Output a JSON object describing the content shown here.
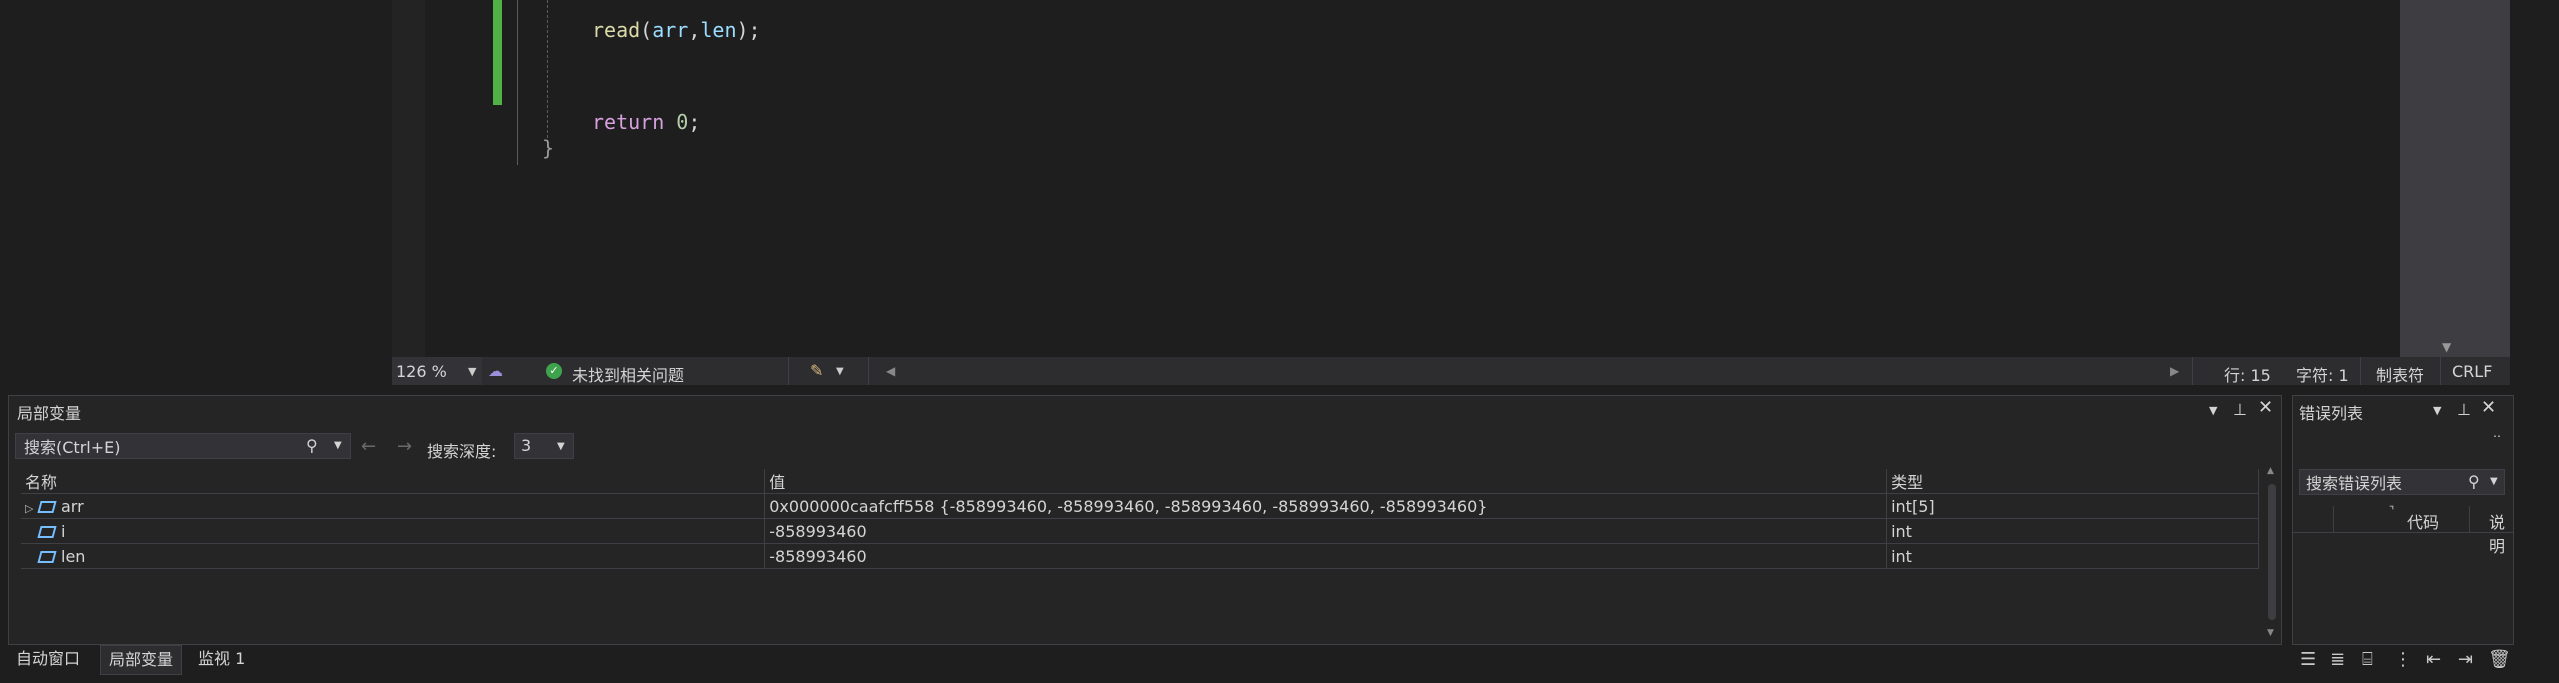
{
  "editor": {
    "line_read": {
      "fn": "read",
      "open": "(",
      "arg1": "arr",
      "comma": ",",
      "arg2": "len",
      "close": ");"
    },
    "line_return": {
      "kw": "return",
      "space": " ",
      "num": "0",
      "semi": ";"
    },
    "brace": "}"
  },
  "status": {
    "zoom": "126 %",
    "issues": "未找到相关问题",
    "line": "行: 15",
    "col": "字符: 1",
    "tabs": "制表符",
    "eol": "CRLF"
  },
  "locals": {
    "title": "局部变量",
    "search_placeholder": "搜索(Ctrl+E)",
    "depth_label": "搜索深度:",
    "depth_value": "3",
    "columns": {
      "name": "名称",
      "value": "值",
      "type": "类型"
    },
    "rows": [
      {
        "name": "arr",
        "value": "0x000000caafcff558 {-858993460, -858993460, -858993460, -858993460, -858993460}",
        "type": "int[5]",
        "expandable": true
      },
      {
        "name": "i",
        "value": "-858993460",
        "type": "int",
        "expandable": false
      },
      {
        "name": "len",
        "value": "-858993460",
        "type": "int",
        "expandable": false
      }
    ]
  },
  "tabs": [
    {
      "label": "自动窗口",
      "active": false
    },
    {
      "label": "局部变量",
      "active": true
    },
    {
      "label": "监视 1",
      "active": false
    }
  ],
  "errors": {
    "title": "错误列表",
    "search_placeholder": "搜索错误列表",
    "col_code": "代码",
    "col_desc": "说明"
  },
  "colors": {
    "change_bar": "#4fb146",
    "keyword": "#d8a0df",
    "function": "#dcdcaa",
    "identifier": "#9cdcfe",
    "number": "#b5cea8"
  }
}
